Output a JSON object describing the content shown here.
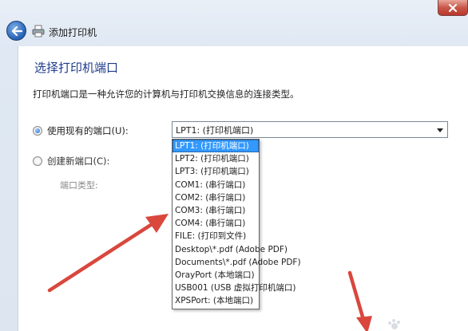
{
  "window": {
    "title": "添加打印机"
  },
  "section": {
    "title": "选择打印机端口",
    "description": "打印机端口是一种允许您的计算机与打印机交换信息的连接类型。"
  },
  "options": {
    "use_existing_label": "使用现有的端口(U):",
    "use_existing_selected": true,
    "create_new_label": "创建新端口(C):",
    "create_new_selected": false,
    "port_type_label": "端口类型:"
  },
  "port_combo": {
    "value": "LPT1: (打印机端口)"
  },
  "port_list": [
    "LPT1: (打印机端口)",
    "LPT2: (打印机端口)",
    "LPT3: (打印机端口)",
    "COM1: (串行端口)",
    "COM2: (串行端口)",
    "COM3: (串行端口)",
    "COM4: (串行端口)",
    "FILE: (打印到文件)",
    "Desktop\\*.pdf (Adobe PDF)",
    "Documents\\*.pdf (Adobe PDF)",
    "OrayPort (本地端口)",
    "USB001 (USB 虚拟打印机端口)",
    "XPSPort: (本地端口)"
  ],
  "selected_port_index": 0,
  "colors": {
    "annotation_arrow": "#d9473d",
    "selection": "#3399ff",
    "title_blue": "#1f3c8c"
  }
}
